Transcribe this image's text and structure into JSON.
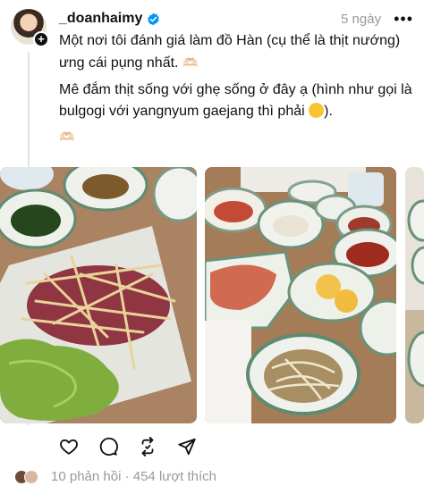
{
  "post": {
    "username": "_doanhaimy",
    "timestamp": "5 ngày",
    "paragraph1": "Một nơi tôi đánh giá làm đồ Hàn (cụ thể là thịt nướng) ưng cái pụng nhất.",
    "paragraph2": "Mê đắm thịt sống với ghẹ sống ở đây ạ (hình như gọi là bulgogi với yangnyum gaejang thì phải",
    "paragraph2_end": ").",
    "emoji_hands": "🫶🏻",
    "replies": "10 phản hồi",
    "separator": "·",
    "likes": "454 lượt thích"
  },
  "icons": {
    "verified": "verified-badge-icon",
    "more": "more-options-icon",
    "like": "heart-icon",
    "reply": "comment-icon",
    "repost": "repost-icon",
    "share": "send-icon"
  },
  "colors": {
    "text": "#101010",
    "secondary": "#999999",
    "verified": "#0095f6"
  }
}
